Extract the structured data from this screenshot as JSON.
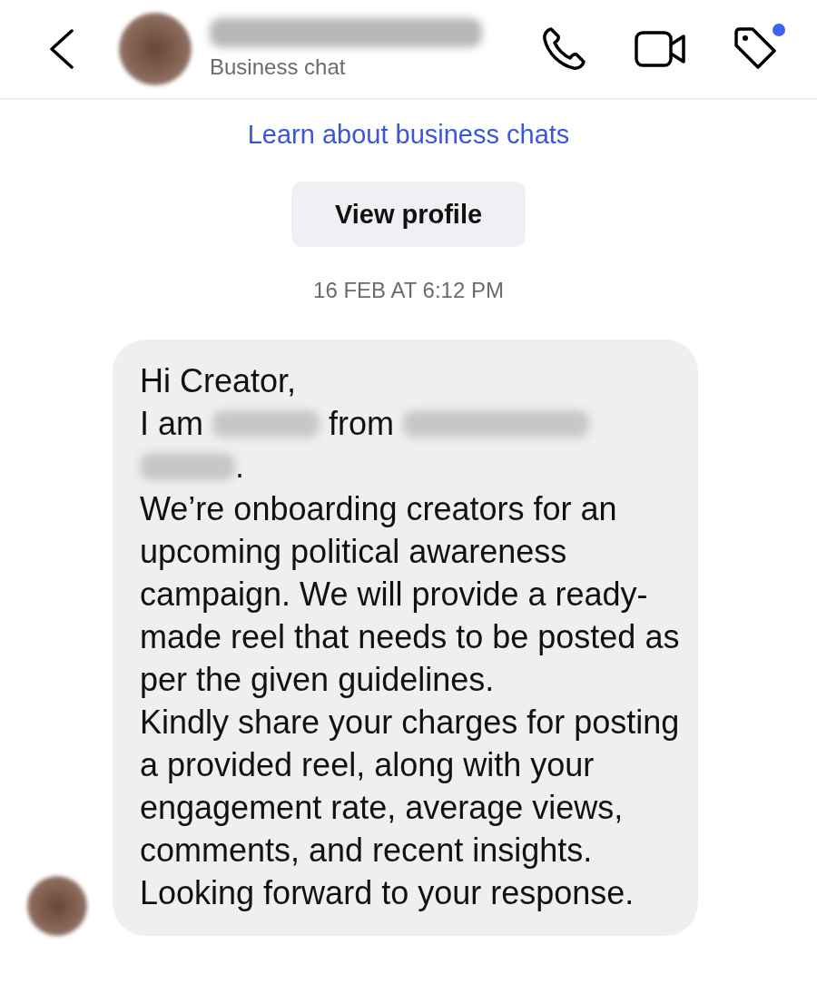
{
  "header": {
    "contact_name_redacted": true,
    "subtitle": "Business chat",
    "tag_badge": true
  },
  "info": {
    "link": "Learn about business chats",
    "button": "View profile"
  },
  "timestamp": "16 FEB AT 6:12 PM",
  "message": {
    "greeting": "Hi Creator,",
    "intro": [
      {
        "kind": "text",
        "text": "I am"
      },
      {
        "kind": "redacted"
      },
      {
        "kind": "text",
        "text": "from"
      },
      {
        "kind": "redacted"
      },
      {
        "kind": "redacted"
      },
      {
        "kind": "text",
        "text": "."
      }
    ],
    "paragraphs": [
      "We’re onboarding creators for an upcoming political awareness campaign. We will provide a ready-made reel that needs to be posted as per the given guidelines.",
      "Kindly share your charges for posting a provided reel, along with your engagement rate, average views, comments, and recent insights. Looking forward to your response."
    ]
  }
}
